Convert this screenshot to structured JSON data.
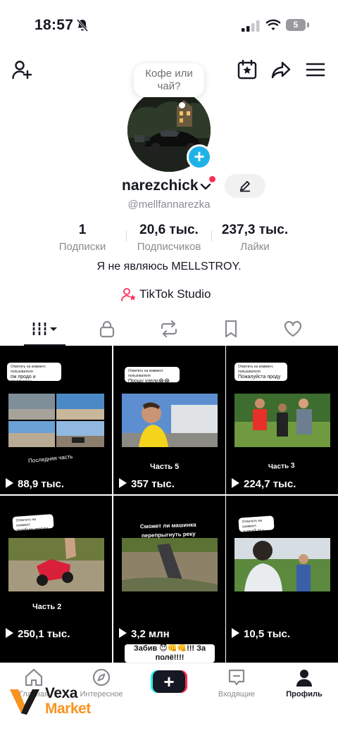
{
  "status_bar": {
    "time": "18:57",
    "battery": "5"
  },
  "top_bar": {
    "icons": [
      "add-friend-icon",
      "calendar-star-icon",
      "share-icon",
      "menu-icon"
    ]
  },
  "note": {
    "text": "Кофе или чай?"
  },
  "profile": {
    "username": "narezchick",
    "handle": "@mellfannarezka",
    "bio": "Я не являюсь MELLSTROY.",
    "studio_label": "TikTok Studio"
  },
  "stats": [
    {
      "value": "1",
      "label": "Подписки"
    },
    {
      "value": "20,6 тыс.",
      "label": "Подписчиков"
    },
    {
      "value": "237,3 тыс.",
      "label": "Лайки"
    }
  ],
  "tabs": [
    "videos-grid-icon",
    "lock-icon",
    "repost-icon",
    "bookmark-icon",
    "heart-icon"
  ],
  "videos": [
    {
      "reply": "Ответить на коммент. пользователя",
      "caption_box": "пж продо и подписки",
      "overlay": "Последняя часть",
      "views": "88,9 тыс."
    },
    {
      "reply": "Ответить на коммент. пользователя",
      "caption_box": "Прошу упели😂😂",
      "overlay": "Часть 5",
      "views": "357 тыс."
    },
    {
      "reply": "Ответить на коммент. пользователя",
      "caption_box": "Пожалуйста проду",
      "overlay": "Часть 3",
      "views": "224,7 тыс."
    },
    {
      "reply": "Ответить на коммент.",
      "caption_box": "требую проду брат",
      "overlay": "Часть 2",
      "views": "250,1 тыс."
    },
    {
      "reply": "",
      "caption_box": "",
      "overlay": "Сможет ли машинка перепрыгнуть реку",
      "views": "3,2 млн"
    },
    {
      "reply": "Ответить на коммент.",
      "caption_box": "давай ты прыгнеш",
      "overlay": "",
      "views": "10,5 тыс."
    }
  ],
  "peek_caption": "Забив 😈👊👊!!! За полё!!!!",
  "bottom_nav": [
    {
      "label": "Главная",
      "icon": "home-icon"
    },
    {
      "label": "Интересное",
      "icon": "compass-icon"
    },
    {
      "label": "",
      "icon": "plus-icon"
    },
    {
      "label": "Входящие",
      "icon": "inbox-icon"
    },
    {
      "label": "Профиль",
      "icon": "profile-icon"
    }
  ],
  "watermark": {
    "line1": "Vexa",
    "line2": "Market"
  },
  "colors": {
    "accent": "#fe2c55",
    "cyan": "#25f4ee",
    "avatar_add": "#1fb2e8",
    "text": "#161823",
    "muted": "#8a8b91",
    "watermark_orange": "#f7931e"
  }
}
